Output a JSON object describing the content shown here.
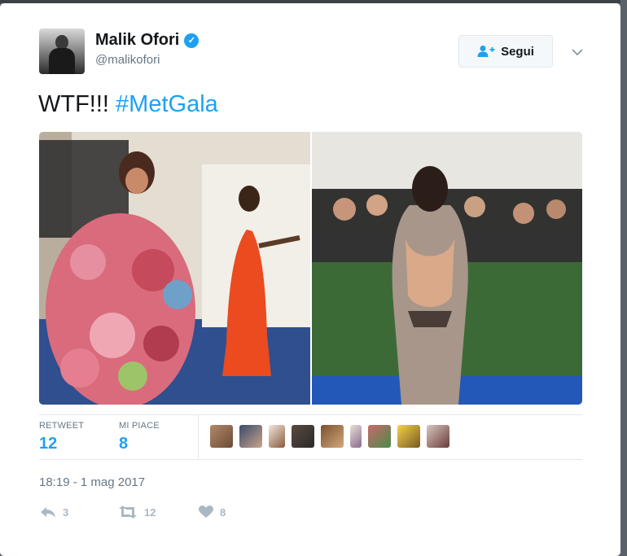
{
  "tweet": {
    "author": {
      "display_name": "Malik Ofori",
      "handle": "@malikofori",
      "verified": true
    },
    "follow_button": {
      "label": "Segui",
      "icon": "add-user-icon"
    },
    "caret_icon": "chevron-down-icon",
    "text": "WTF!!!",
    "hashtag": "#MetGala",
    "media": [
      {
        "description_icon": "photo-1"
      },
      {
        "description_icon": "photo-2"
      }
    ],
    "stats": {
      "retweets": {
        "label": "RETWEET",
        "value": "12"
      },
      "likes": {
        "label": "MI PIACE",
        "value": "8"
      }
    },
    "liker_count_shown": 9,
    "timestamp": "18:19 - 1 mag 2017",
    "actions": {
      "reply": {
        "icon": "reply-icon",
        "count": "3"
      },
      "retweet": {
        "icon": "retweet-icon",
        "count": "12"
      },
      "like": {
        "icon": "heart-icon",
        "count": "8"
      }
    }
  },
  "colors": {
    "accent": "#1da1f2",
    "muted": "#657786",
    "action_gray": "#aab8c2"
  }
}
